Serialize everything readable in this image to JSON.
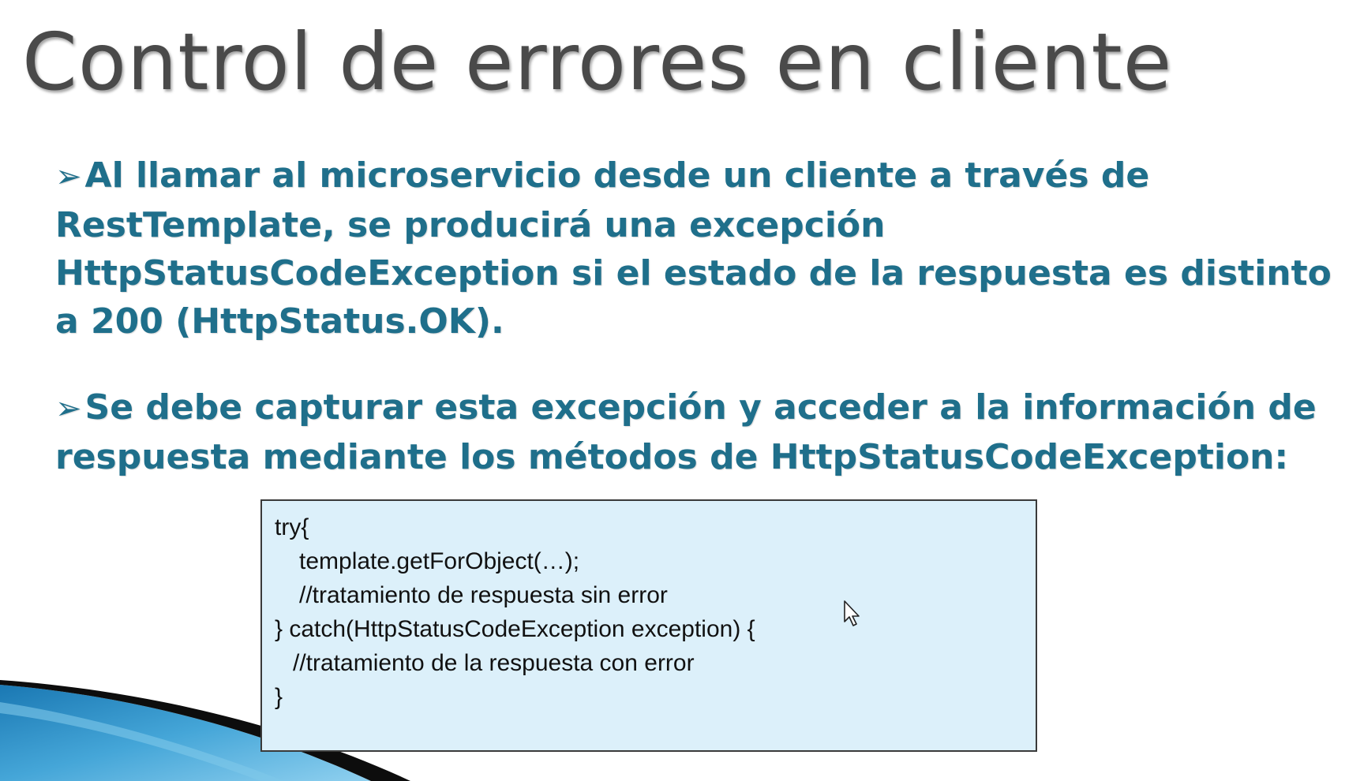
{
  "slide": {
    "title": "Control de errores en cliente",
    "bullets": [
      "Al llamar al microservicio desde un cliente a través de RestTemplate, se producirá una excepción HttpStatusCodeException si el estado de la respuesta es distinto a 200 (HttpStatus.OK).",
      "Se debe capturar esta excepción y acceder a la información de respuesta mediante los métodos de HttpStatusCodeException:"
    ],
    "bullet_icon": "arrow-bullet-icon",
    "code_lines": [
      "try{",
      "template.getForObject(…);",
      "//tratamiento de respuesta sin error",
      "} catch(HttpStatusCodeException exception) {",
      "//tratamiento de la respuesta con error",
      "}"
    ]
  },
  "colors": {
    "title": "#4a4a4a",
    "bullet_text": "#1f6f8b",
    "code_background": "#dcf0fa",
    "swoosh_blue": "#2f8fc4"
  },
  "icons": {
    "cursor": "mouse-pointer-icon",
    "decoration": "swoosh-decoration"
  }
}
